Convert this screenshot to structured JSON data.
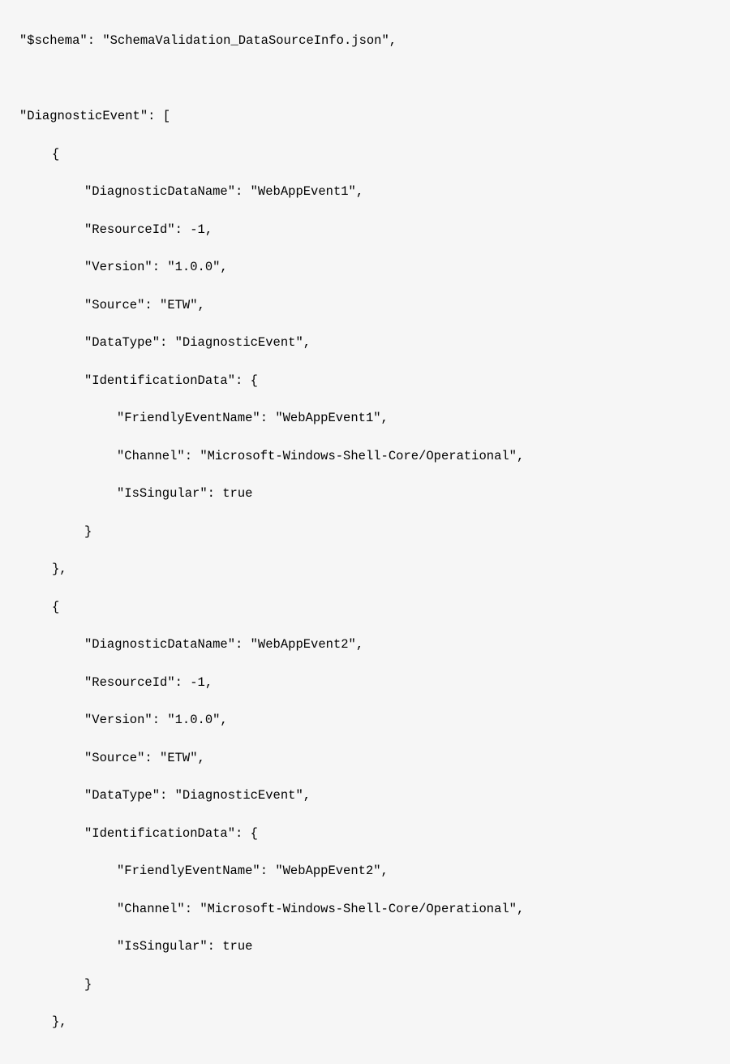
{
  "code": {
    "schemaLine": "\"$schema\": \"SchemaValidation_DataSourceInfo.json\",",
    "diagEventHeader": "\"DiagnosticEvent\": [",
    "events": [
      {
        "openBrace": "{",
        "diagnosticDataName": "\"DiagnosticDataName\": \"WebAppEvent1\",",
        "resourceId": "\"ResourceId\": -1,",
        "version": "\"Version\": \"1.0.0\",",
        "source": "\"Source\": \"ETW\",",
        "dataType": "\"DataType\": \"DiagnosticEvent\",",
        "identDataOpen": "\"IdentificationData\": {",
        "friendlyEventName": "\"FriendlyEventName\": \"WebAppEvent1\",",
        "channel": "\"Channel\": \"Microsoft-Windows-Shell-Core/Operational\",",
        "isSingular": "\"IsSingular\": true",
        "identDataClose": "}",
        "closeBrace": "},"
      },
      {
        "openBrace": "{",
        "diagnosticDataName": "\"DiagnosticDataName\": \"WebAppEvent2\",",
        "resourceId": "\"ResourceId\": -1,",
        "version": "\"Version\": \"1.0.0\",",
        "source": "\"Source\": \"ETW\",",
        "dataType": "\"DataType\": \"DiagnosticEvent\",",
        "identDataOpen": "\"IdentificationData\": {",
        "friendlyEventName": "\"FriendlyEventName\": \"WebAppEvent2\",",
        "channel": "\"Channel\": \"Microsoft-Windows-Shell-Core/Operational\",",
        "isSingular": "\"IsSingular\": true",
        "identDataClose": "}",
        "closeBrace": "},"
      }
    ]
  }
}
